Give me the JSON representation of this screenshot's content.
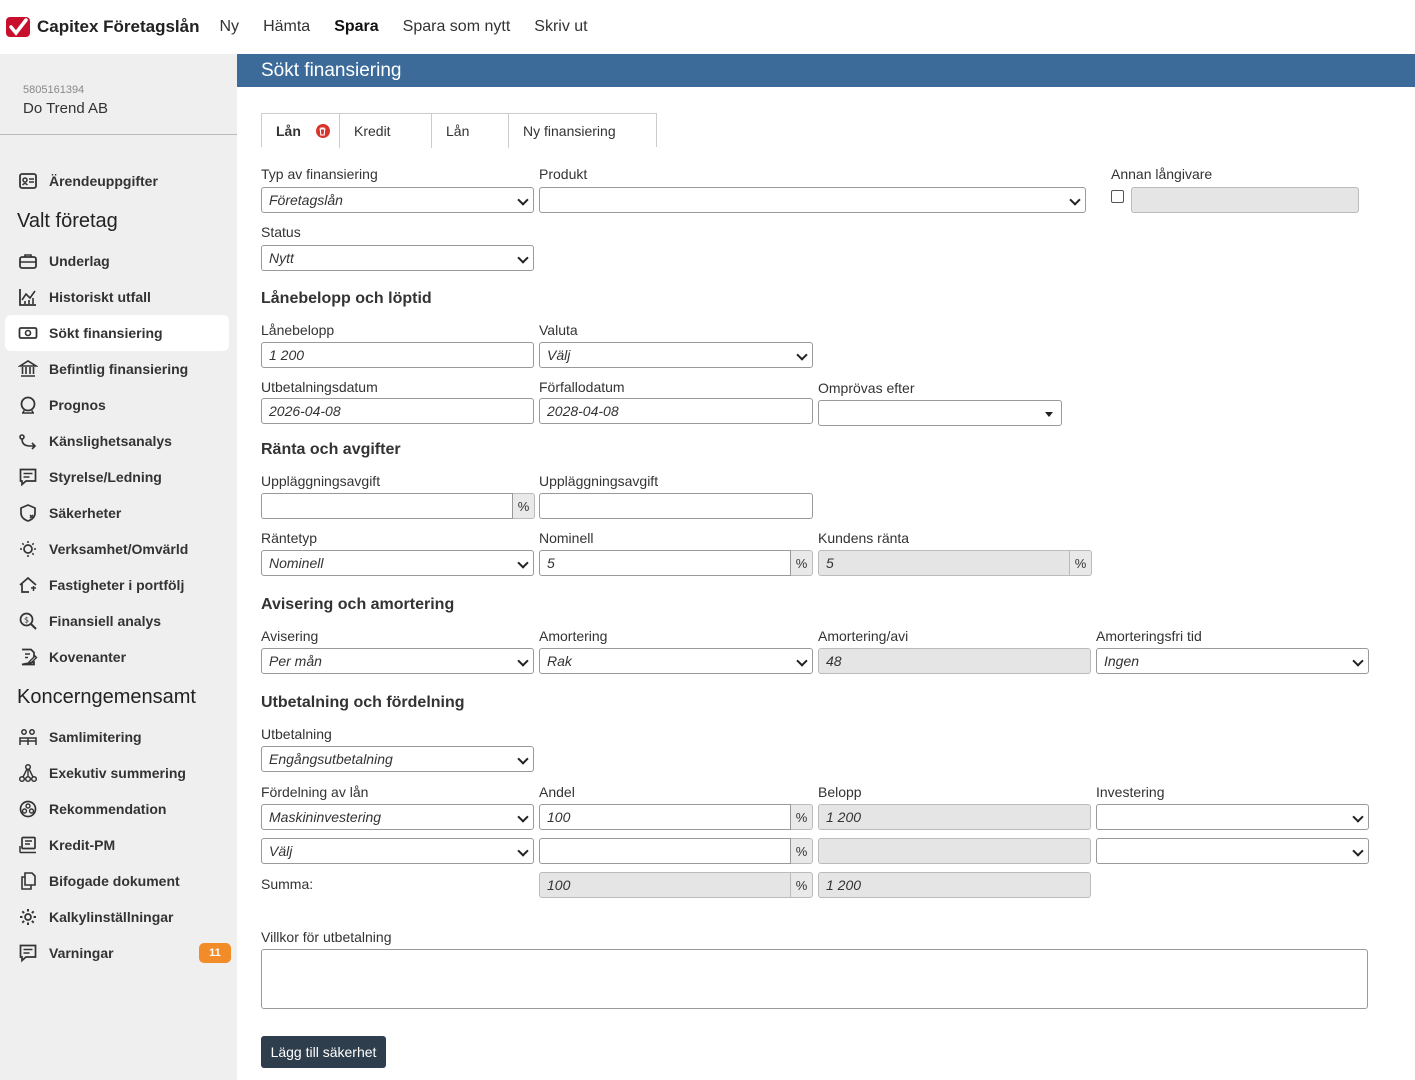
{
  "app": {
    "name": "Capitex Företagslån"
  },
  "topnav": [
    {
      "label": "Ny",
      "bold": false
    },
    {
      "label": "Hämta",
      "bold": false
    },
    {
      "label": "Spara",
      "bold": true
    },
    {
      "label": "Spara som nytt",
      "bold": false
    },
    {
      "label": "Skriv ut",
      "bold": false
    }
  ],
  "company": {
    "orgnr": "5805161394",
    "name": "Do Trend AB"
  },
  "sidebar": {
    "top_item": "Ärendeuppgifter",
    "section1": "Valt företag",
    "items1": [
      "Underlag",
      "Historiskt utfall",
      "Sökt finansiering",
      "Befintlig finansiering",
      "Prognos",
      "Känslighetsanalys",
      "Styrelse/Ledning",
      "Säkerheter",
      "Verksamhet/Omvärld",
      "Fastigheter i portfölj",
      "Finansiell analys",
      "Kovenanter"
    ],
    "section2": "Koncerngemensamt",
    "items2": [
      "Samlimitering",
      "Exekutiv summering",
      "Rekommendation",
      "Kredit-PM",
      "Bifogade dokument",
      "Kalkylinställningar",
      "Varningar"
    ],
    "warnings_count": "11"
  },
  "main": {
    "title": "Sökt finansiering",
    "tabs": [
      "Lån",
      "Kredit",
      "Lån",
      "Ny finansiering"
    ]
  },
  "form": {
    "typ_label": "Typ av finansiering",
    "typ_value": "Företagslån",
    "produkt_label": "Produkt",
    "produkt_value": "",
    "annan_label": "Annan långivare",
    "status_label": "Status",
    "status_value": "Nytt",
    "sect_lane": "Lånebelopp och löptid",
    "lanebelopp_label": "Lånebelopp",
    "lanebelopp_value": "1 200",
    "valuta_label": "Valuta",
    "valuta_value": "Välj",
    "utbet_datum_label": "Utbetalningsdatum",
    "utbet_datum_value": "2026-04-08",
    "forfall_label": "Förfallodatum",
    "forfall_value": "2028-04-08",
    "omprovas_label": "Omprövas efter",
    "omprovas_value": "",
    "sect_ranta": "Ränta och avgifter",
    "uppl1_label": "Uppläggningsavgift",
    "uppl1_value": "",
    "uppl2_label": "Uppläggningsavgift",
    "uppl2_value": "",
    "rantetyp_label": "Räntetyp",
    "rantetyp_value": "Nominell",
    "nominell_label": "Nominell",
    "nominell_value": "5",
    "kundens_label": "Kundens ränta",
    "kundens_value": "5",
    "sect_avisering": "Avisering och amortering",
    "avisering_label": "Avisering",
    "avisering_value": "Per mån",
    "amortering_label": "Amortering",
    "amortering_value": "Rak",
    "amort_avi_label": "Amortering/avi",
    "amort_avi_value": "48",
    "amortfri_label": "Amorteringsfri tid",
    "amortfri_value": "Ingen",
    "sect_utbet": "Utbetalning och fördelning",
    "utbetalning_label": "Utbetalning",
    "utbetalning_value": "Engångsutbetalning",
    "fordelning_label": "Fördelning av lån",
    "andel_label": "Andel",
    "belopp_label": "Belopp",
    "investering_label": "Investering",
    "row1": {
      "fordelning": "Maskininvestering",
      "andel": "100",
      "belopp": "1 200",
      "investering": ""
    },
    "row2": {
      "fordelning": "Välj",
      "andel": "",
      "belopp": "",
      "investering": ""
    },
    "summa_label": "Summa:",
    "summa_andel": "100",
    "summa_belopp": "1 200",
    "villkor_label": "Villkor för utbetalning",
    "add_button": "Lägg till säkerhet",
    "pct": "%"
  }
}
